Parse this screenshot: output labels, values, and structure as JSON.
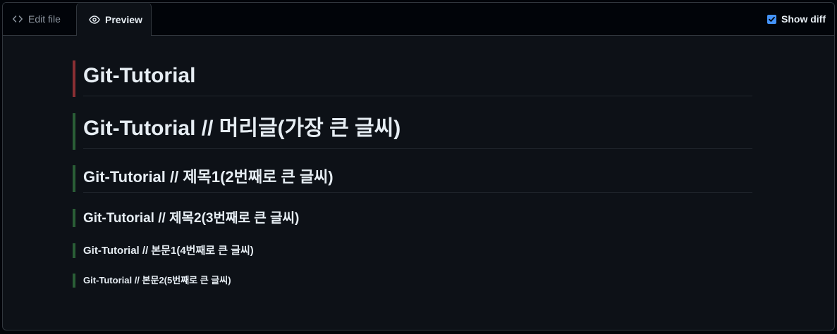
{
  "tabs": {
    "edit_label": "Edit file",
    "preview_label": "Preview"
  },
  "show_diff": {
    "label": "Show diff",
    "checked": true
  },
  "preview": {
    "removed_heading": "Git-Tutorial",
    "h1": "Git-Tutorial // 머리글(가장 큰 글씨)",
    "h2": "Git-Tutorial // 제목1(2번째로 큰 글씨)",
    "h3": "Git-Tutorial // 제목2(3번째로 큰 글씨)",
    "h4": "Git-Tutorial // 본문1(4번째로 큰 글씨)",
    "h5": "Git-Tutorial // 본문2(5번째로 큰 글씨)"
  },
  "colors": {
    "removed_marker": "#8a2f33",
    "added_marker": "#2a5e36",
    "accent": "#4493f8"
  }
}
